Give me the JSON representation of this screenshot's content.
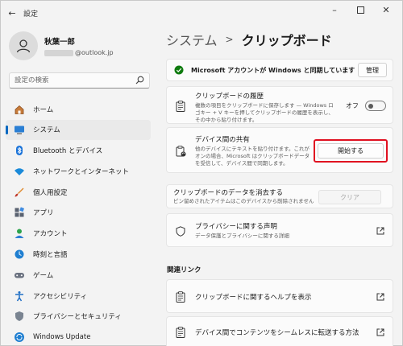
{
  "window": {
    "title": "設定"
  },
  "profile": {
    "name": "秋葉一郎",
    "email_visible": "@outlook.jp"
  },
  "search": {
    "placeholder": "設定の検索"
  },
  "sidebar": {
    "items": [
      {
        "label": "ホーム",
        "icon": "home-icon"
      },
      {
        "label": "システム",
        "icon": "system-icon",
        "active": true
      },
      {
        "label": "Bluetooth とデバイス",
        "icon": "bluetooth-icon"
      },
      {
        "label": "ネットワークとインターネット",
        "icon": "network-icon"
      },
      {
        "label": "個人用設定",
        "icon": "brush-icon"
      },
      {
        "label": "アプリ",
        "icon": "apps-icon"
      },
      {
        "label": "アカウント",
        "icon": "account-icon"
      },
      {
        "label": "時刻と言語",
        "icon": "time-language-icon"
      },
      {
        "label": "ゲーム",
        "icon": "gamepad-icon"
      },
      {
        "label": "アクセシビリティ",
        "icon": "accessibility-icon"
      },
      {
        "label": "プライバシーとセキュリティ",
        "icon": "shield-icon"
      },
      {
        "label": "Windows Update",
        "icon": "update-icon"
      }
    ]
  },
  "header": {
    "parent": "システム",
    "separator": ">",
    "current": "クリップボード"
  },
  "sync_card": {
    "text": "Microsoft アカウントが Windows と同期しています",
    "button": "管理"
  },
  "history_card": {
    "title": "クリップボードの履歴",
    "desc": "複数の項目をクリップボードに保存します — Windows ロゴキー + V キーを押してクリップボードの履歴を表示し、その中から貼り付けます。",
    "toggle_label": "オフ",
    "toggle_on": false
  },
  "share_card": {
    "title": "デバイス間の共有",
    "desc": "他のデバイスにテキストを貼り付けます。これがオンの場合、Microsoft はクリップボードデータを受信して、デバイス間で同期します。",
    "button": "開始する"
  },
  "clear_card": {
    "title": "クリップボードのデータを消去する",
    "desc": "ピン留めされたアイテムはこのデバイスから削除されません",
    "button": "クリア"
  },
  "privacy_card": {
    "title": "プライバシーに関する声明",
    "desc": "データ保護とプライバシーに関する詳細"
  },
  "related": {
    "heading": "関連リンク",
    "links": [
      {
        "label": "クリップボードに関するヘルプを表示"
      },
      {
        "label": "デバイス間でコンテンツをシームレスに転送する方法"
      }
    ]
  },
  "colors": {
    "accent": "#0067c0",
    "highlight": "#e01020",
    "success": "#0f7b0f"
  }
}
